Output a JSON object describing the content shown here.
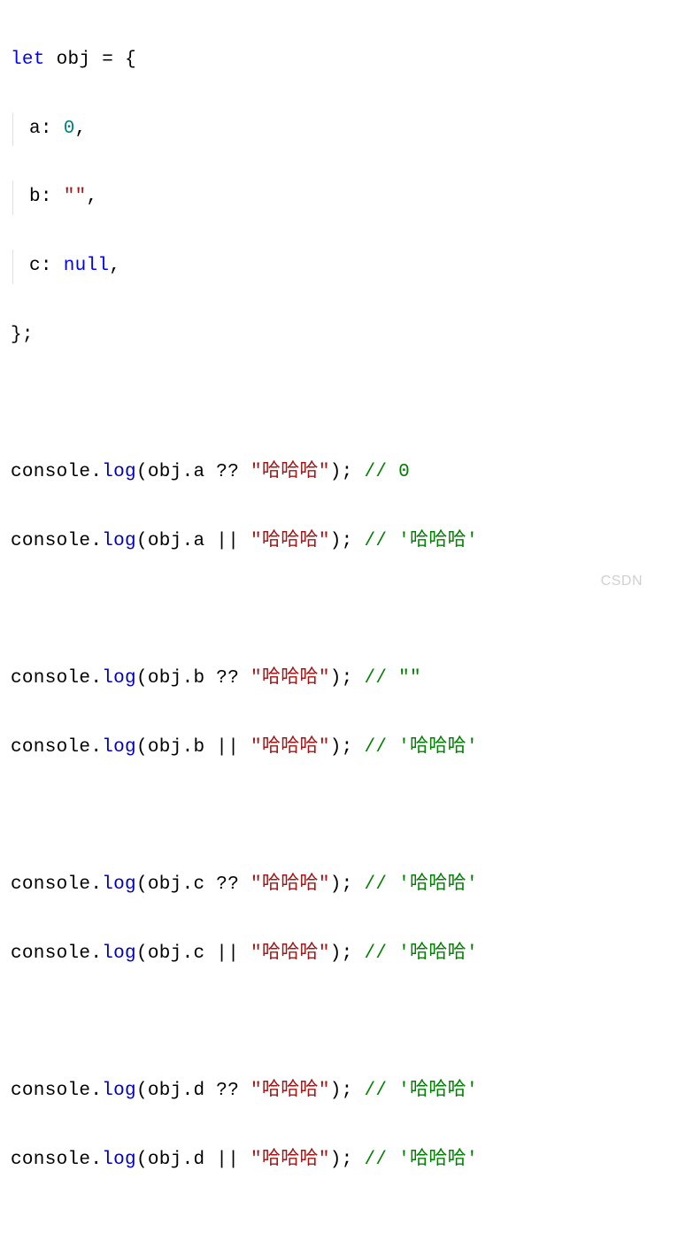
{
  "code": {
    "line1": {
      "kw_let": "let",
      "id_obj": "obj",
      "op_eq": "=",
      "brace_open": "{"
    },
    "line2": {
      "key": "a",
      "colon": ":",
      "value": "0",
      "comma": ","
    },
    "line3": {
      "key": "b",
      "colon": ":",
      "value": "\"\"",
      "comma": ","
    },
    "line4": {
      "key": "c",
      "colon": ":",
      "value": "null",
      "comma": ","
    },
    "line5": {
      "brace_close": "}",
      "semi": ";"
    },
    "blank": "",
    "log_lines": [
      {
        "console": "console",
        "dot1": ".",
        "log": "log",
        "paren_open": "(",
        "obj": "obj",
        "dot2": ".",
        "prop": "a",
        "sp": " ",
        "op": "??",
        "str": "\"哈哈哈\"",
        "paren_close": ")",
        "semi": ";",
        "comment": "// 0"
      },
      {
        "console": "console",
        "dot1": ".",
        "log": "log",
        "paren_open": "(",
        "obj": "obj",
        "dot2": ".",
        "prop": "a",
        "sp": " ",
        "op": "||",
        "str": "\"哈哈哈\"",
        "paren_close": ")",
        "semi": ";",
        "comment": "// '哈哈哈'"
      },
      {
        "console": "console",
        "dot1": ".",
        "log": "log",
        "paren_open": "(",
        "obj": "obj",
        "dot2": ".",
        "prop": "b",
        "sp": " ",
        "op": "??",
        "str": "\"哈哈哈\"",
        "paren_close": ")",
        "semi": ";",
        "comment": "// \"\""
      },
      {
        "console": "console",
        "dot1": ".",
        "log": "log",
        "paren_open": "(",
        "obj": "obj",
        "dot2": ".",
        "prop": "b",
        "sp": " ",
        "op": "||",
        "str": "\"哈哈哈\"",
        "paren_close": ")",
        "semi": ";",
        "comment": "// '哈哈哈'"
      },
      {
        "console": "console",
        "dot1": ".",
        "log": "log",
        "paren_open": "(",
        "obj": "obj",
        "dot2": ".",
        "prop": "c",
        "sp": " ",
        "op": "??",
        "str": "\"哈哈哈\"",
        "paren_close": ")",
        "semi": ";",
        "comment": "// '哈哈哈'"
      },
      {
        "console": "console",
        "dot1": ".",
        "log": "log",
        "paren_open": "(",
        "obj": "obj",
        "dot2": ".",
        "prop": "c",
        "sp": " ",
        "op": "||",
        "str": "\"哈哈哈\"",
        "paren_close": ")",
        "semi": ";",
        "comment": "// '哈哈哈'"
      },
      {
        "console": "console",
        "dot1": ".",
        "log": "log",
        "paren_open": "(",
        "obj": "obj",
        "dot2": ".",
        "prop": "d",
        "sp": " ",
        "op": "??",
        "str": "\"哈哈哈\"",
        "paren_close": ")",
        "semi": ";",
        "comment": "// '哈哈哈'"
      },
      {
        "console": "console",
        "dot1": ".",
        "log": "log",
        "paren_open": "(",
        "obj": "obj",
        "dot2": ".",
        "prop": "d",
        "sp": " ",
        "op": "||",
        "str": "\"哈哈哈\"",
        "paren_close": ")",
        "semi": ";",
        "comment": "// '哈哈哈'"
      }
    ]
  },
  "watermark": "CSDN"
}
